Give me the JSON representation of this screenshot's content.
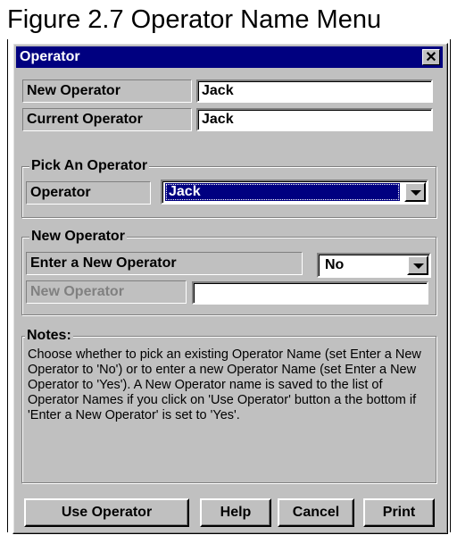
{
  "figure_caption": "Figure 2.7  Operator Name Menu",
  "window": {
    "title": "Operator",
    "close_symbol": "✕"
  },
  "fields": {
    "new_operator": {
      "label": "New Operator",
      "value": "Jack"
    },
    "current_operator": {
      "label": "Current Operator",
      "value": "Jack"
    }
  },
  "pick_group": {
    "legend": "Pick An Operator",
    "label": "Operator",
    "selected": "Jack"
  },
  "new_group": {
    "legend": "New Operator",
    "enter_label": "Enter a New Operator",
    "enter_value": "No",
    "new_label": "New Operator",
    "new_value": ""
  },
  "notes": {
    "legend": "Notes:",
    "text": "Choose whether to pick an existing Operator Name (set Enter a New Operator to 'No') or to enter a new Operator Name (set Enter a New Operator to 'Yes').  A New Operator name is saved to the list of Operator Names if you click on 'Use Operator' button a the bottom if 'Enter a New Operator' is set to 'Yes'."
  },
  "buttons": {
    "use_operator": "Use Operator",
    "help": "Help",
    "cancel": "Cancel",
    "print": "Print"
  },
  "icons": {
    "close": "close-icon",
    "dropdown": "chevron-down-icon"
  }
}
